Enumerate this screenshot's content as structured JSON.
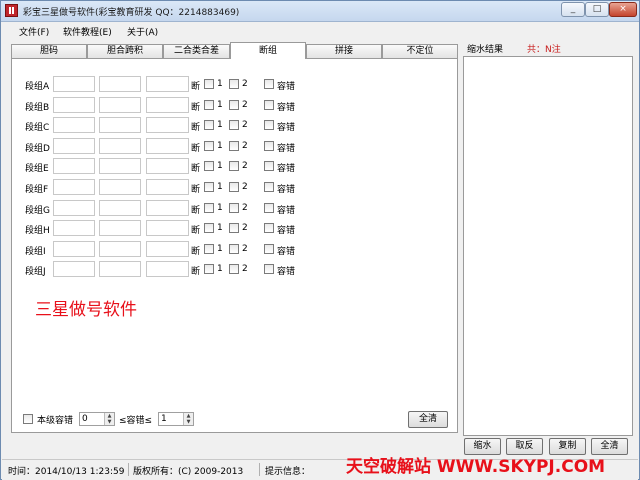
{
  "window": {
    "title": "彩宝三星做号软件(彩宝教育研发 QQ：2214883469)",
    "controls": [
      "_",
      "□",
      "×"
    ]
  },
  "menu": [
    "文件(F)",
    "软件教程(E)",
    "关于(A)"
  ],
  "tabs": [
    {
      "label": "胆码",
      "active": false
    },
    {
      "label": "胆合跨积",
      "active": false
    },
    {
      "label": "二合类合差",
      "active": false
    },
    {
      "label": "断组",
      "active": true
    },
    {
      "label": "拼接",
      "active": false
    },
    {
      "label": "不定位",
      "active": false
    }
  ],
  "groups": [
    {
      "label": "段组A"
    },
    {
      "label": "段组B"
    },
    {
      "label": "段组C"
    },
    {
      "label": "段组D"
    },
    {
      "label": "段组E"
    },
    {
      "label": "段组F"
    },
    {
      "label": "段组G"
    },
    {
      "label": "段组H"
    },
    {
      "label": "段组I"
    },
    {
      "label": "段组J"
    }
  ],
  "row_labels": {
    "duan": "断",
    "opt1": "1",
    "opt2": "2",
    "rongcuo": "容错"
  },
  "brand_text": "三星做号软件",
  "bottom": {
    "level_checkbox": "本级容错",
    "min_value": "0",
    "range_text": "≤容错≤",
    "max_value": "1",
    "clear_button": "全清"
  },
  "right_panel": {
    "heading": "缩水结果",
    "count": "共：N注",
    "buttons": [
      "缩水",
      "取反",
      "复制",
      "全清"
    ]
  },
  "status": {
    "time": "时间：2014/10/13 1:23:59",
    "copyright": "版权所有：(C) 2009-2013",
    "hint": "提示信息："
  },
  "watermark": "天空破解站 WWW.SKYPJ.COM",
  "colors": {
    "accent_red": "#e8101a",
    "count_red": "#c81e1e"
  }
}
